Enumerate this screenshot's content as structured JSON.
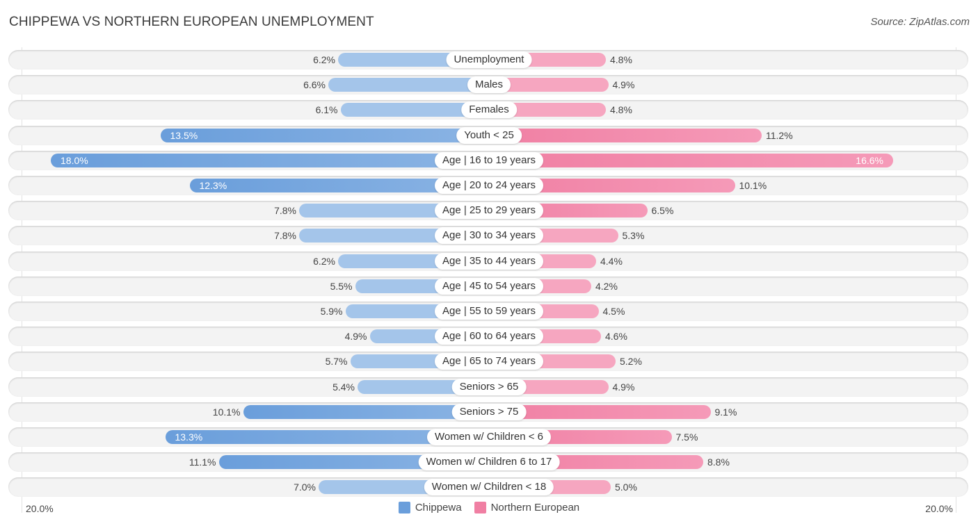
{
  "header": {
    "title": "CHIPPEWA VS NORTHERN EUROPEAN UNEMPLOYMENT",
    "source": "Source: ZipAtlas.com"
  },
  "colors": {
    "chippewa": "#6a9edb",
    "northern_european": "#f07fa3"
  },
  "chart_data": {
    "type": "bar",
    "orientation": "horizontal-diverging",
    "title": "CHIPPEWA VS NORTHERN EUROPEAN UNEMPLOYMENT",
    "categories": [
      "Unemployment",
      "Males",
      "Females",
      "Youth < 25",
      "Age | 16 to 19 years",
      "Age | 20 to 24 years",
      "Age | 25 to 29 years",
      "Age | 30 to 34 years",
      "Age | 35 to 44 years",
      "Age | 45 to 54 years",
      "Age | 55 to 59 years",
      "Age | 60 to 64 years",
      "Age | 65 to 74 years",
      "Seniors > 65",
      "Seniors > 75",
      "Women w/ Children < 6",
      "Women w/ Children 6 to 17",
      "Women w/ Children < 18"
    ],
    "series": [
      {
        "name": "Chippewa",
        "side": "left",
        "values": [
          6.2,
          6.6,
          6.1,
          13.5,
          18.0,
          12.3,
          7.8,
          7.8,
          6.2,
          5.5,
          5.9,
          4.9,
          5.7,
          5.4,
          10.1,
          13.3,
          11.1,
          7.0
        ],
        "labels": [
          "6.2%",
          "6.6%",
          "6.1%",
          "13.5%",
          "18.0%",
          "12.3%",
          "7.8%",
          "7.8%",
          "6.2%",
          "5.5%",
          "5.9%",
          "4.9%",
          "5.7%",
          "5.4%",
          "10.1%",
          "13.3%",
          "11.1%",
          "7.0%"
        ]
      },
      {
        "name": "Northern European",
        "side": "right",
        "values": [
          4.8,
          4.9,
          4.8,
          11.2,
          16.6,
          10.1,
          6.5,
          5.3,
          4.4,
          4.2,
          4.5,
          4.6,
          5.2,
          4.9,
          9.1,
          7.5,
          8.8,
          5.0
        ],
        "labels": [
          "4.8%",
          "4.9%",
          "4.8%",
          "11.2%",
          "16.6%",
          "10.1%",
          "6.5%",
          "5.3%",
          "4.4%",
          "4.2%",
          "4.5%",
          "4.6%",
          "5.2%",
          "4.9%",
          "9.1%",
          "7.5%",
          "8.8%",
          "5.0%"
        ]
      }
    ],
    "xlim": [
      -20.0,
      20.0
    ],
    "axis_labels": {
      "left": "20.0%",
      "right": "20.0%"
    },
    "legend": {
      "position": "bottom-center",
      "entries": [
        "Chippewa",
        "Northern European"
      ]
    },
    "grid": false
  }
}
